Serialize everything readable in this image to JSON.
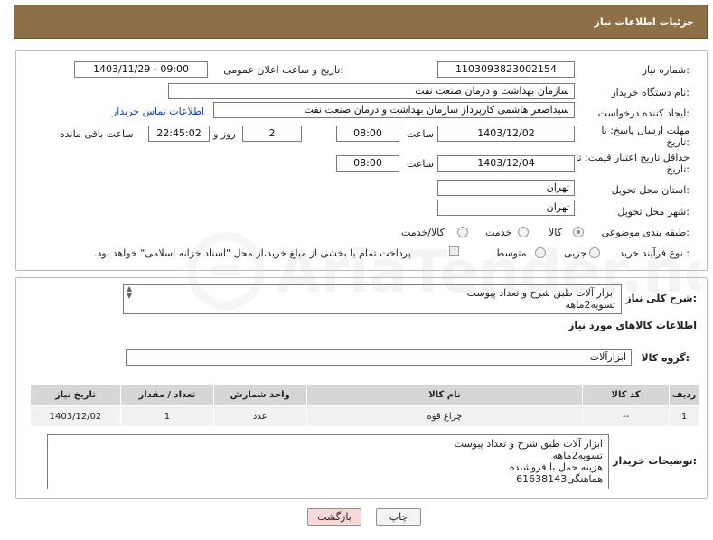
{
  "header": {
    "title": "جزئیات اطلاعات نیاز"
  },
  "labels": {
    "need_number": "شماره نیاز:",
    "announce_datetime": "تاریخ و ساعت اعلان عمومی:",
    "buyer_org": "نام دستگاه خریدار:",
    "requester": "ایجاد کننده درخواست:",
    "reply_deadline": "مهلت ارسال پاسخ: تا",
    "reply_deadline_2": "تاریخ:",
    "time_word": "ساعت",
    "day_and": "روز و",
    "remaining": "ساعت باقی مانده",
    "price_validity": "حداقل تاریخ اعتبار قیمت: تا",
    "price_validity_2": "تاریخ:",
    "province": "استان محل تحویل:",
    "city": "شهر محل تحویل:",
    "category": "طبقه بندی موضوعی:",
    "purchase_type": "نوع فرآیند خرید :",
    "need_summary": "شرح کلی نیاز:",
    "goods_info": "اطلاعات کالاهای مورد نیاز",
    "goods_group": "گروه کالا:",
    "buyer_notes": "توضیحات خریدار:"
  },
  "values": {
    "need_number": "1103093823002154",
    "announce_datetime": "1403/11/29 - 09:00",
    "buyer_org": "سازمان بهداشت و درمان صنعت نفت",
    "requester": "سیداصغر هاشمی کارپرداز سازمان بهداشت و درمان صنعت نفت",
    "contact_link": "اطلاعات تماس خریدار",
    "reply_date": "1403/12/02",
    "reply_time": "08:00",
    "reply_days": "2",
    "reply_remaining": "22:45:02",
    "price_date": "1403/12/04",
    "price_time": "08:00",
    "province": "تهران",
    "city": "تهران",
    "need_summary_line1": "ابزار آلات طبق شرح و تعداد پیوست",
    "need_summary_line2": "تسویه2ماهه",
    "goods_group": "ابزارآلات"
  },
  "category_options": [
    {
      "label": "کالا",
      "selected": true
    },
    {
      "label": "خدمت",
      "selected": false
    },
    {
      "label": "کالا/خدمت",
      "selected": false
    }
  ],
  "purchase_options": [
    {
      "label": "جزیی",
      "selected": false
    },
    {
      "label": "متوسط",
      "selected": false
    }
  ],
  "payment_note": "پرداخت تمام یا بخشی از مبلغ خرید،از محل \"اسناد خزانه اسلامی\" خواهد بود.",
  "table": {
    "headers": [
      "ردیف",
      "کد کالا",
      "نام کالا",
      "واحد شمارش",
      "تعداد / مقدار",
      "تاریخ نیاز"
    ],
    "rows": [
      [
        "1",
        "--",
        "چراغ قوه",
        "عدد",
        "1",
        "1403/12/02"
      ]
    ]
  },
  "buyer_notes": [
    "ابزار آلات طبق شرح و تعداد پیوست",
    "تسویه2ماهه",
    "هزینه حمل با فروشنده",
    "هماهنگی61638143"
  ],
  "buttons": {
    "print": "چاپ",
    "back": "بازگشت"
  },
  "watermark": {
    "text": "AriaTender.neT"
  },
  "colors": {
    "header_bg": "#8d7048",
    "link": "#1a3fa8",
    "back_button_bg": "#f7d9d9"
  }
}
